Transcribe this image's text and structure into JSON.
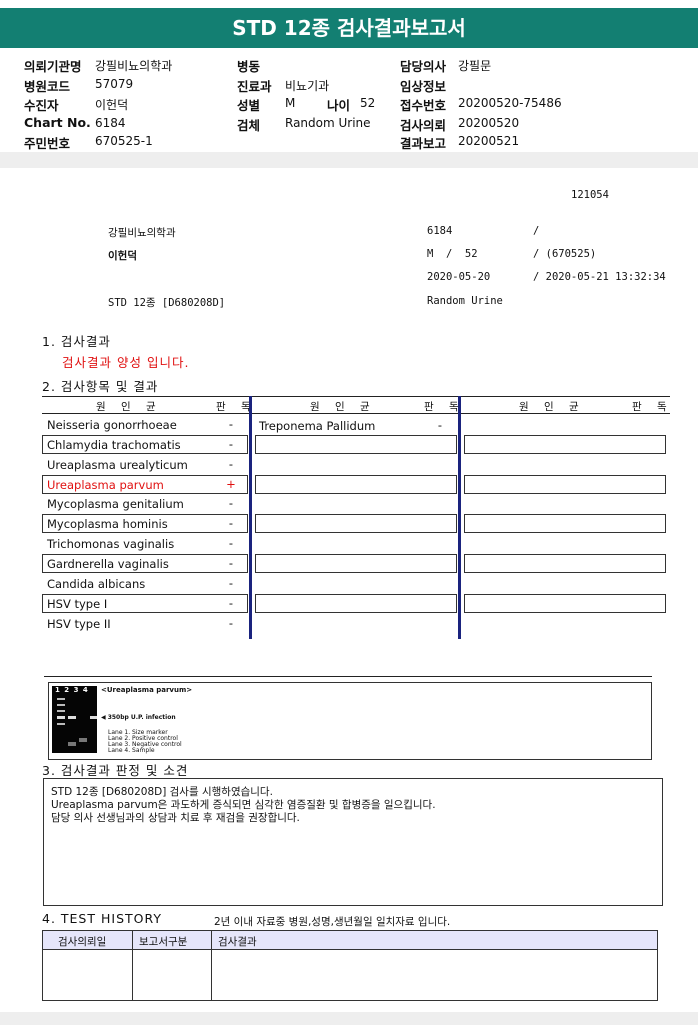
{
  "title": "STD 12종 검사결과보고서",
  "header": {
    "fields": [
      {
        "label": "의뢰기관명",
        "value": "강필비뇨의학과"
      },
      {
        "label": "병원코드",
        "value": "57079"
      },
      {
        "label": "수진자",
        "value": "이헌덕"
      },
      {
        "label": "Chart No.",
        "value": "6184"
      },
      {
        "label": "주민번호",
        "value": "670525-1"
      },
      {
        "label": "병동",
        "value": ""
      },
      {
        "label": "진료과",
        "value": "비뇨기과"
      },
      {
        "label": "성별",
        "value": "M"
      },
      {
        "label": "나이",
        "value": "52"
      },
      {
        "label": "검체",
        "value": "Random Urine"
      },
      {
        "label": "담당의사",
        "value": "강필문"
      },
      {
        "label": "임상정보",
        "value": ""
      },
      {
        "label": "접수번호",
        "value": "20200520-75486"
      },
      {
        "label": "검사의뢰",
        "value": "20200520"
      },
      {
        "label": "결과보고",
        "value": "20200521"
      }
    ]
  },
  "report": {
    "code": "121054",
    "clinic": "강필비뇨의학과",
    "chart": "6184",
    "slash1": "/",
    "patient": "이헌덕",
    "sex_age": "M  /  52",
    "id_part": "/ (670525)",
    "receipt_date": "2020-05-20",
    "report_datetime": "/ 2020-05-21 13:32:34",
    "test_name": "STD 12종 [D680208D]",
    "specimen": "Random Urine"
  },
  "section1": {
    "title": "1. 검사결과",
    "result": "검사결과 양성 입니다."
  },
  "section2": {
    "title": "2. 검사항목 및 결과",
    "col_pathogen": "원 인 균",
    "col_result": "판 독",
    "items": [
      {
        "name": "Neisseria gonorrhoeae",
        "result": "-"
      },
      {
        "name": "Chlamydia trachomatis",
        "result": "-"
      },
      {
        "name": "Ureaplasma urealyticum",
        "result": "-"
      },
      {
        "name": "Ureaplasma parvum",
        "result": "+"
      },
      {
        "name": "Mycoplasma genitalium",
        "result": "-"
      },
      {
        "name": "Mycoplasma hominis",
        "result": "-"
      },
      {
        "name": "Trichomonas vaginalis",
        "result": "-"
      },
      {
        "name": "Gardnerella vaginalis",
        "result": "-"
      },
      {
        "name": "Candida albicans",
        "result": "-"
      },
      {
        "name": "HSV type I",
        "result": "-"
      },
      {
        "name": "HSV type II",
        "result": "-"
      }
    ],
    "items2": [
      {
        "name": "Treponema Pallidum",
        "result": "-"
      }
    ]
  },
  "figure": {
    "lanes": "1 2 3 4",
    "title": "<Ureaplasma parvum>",
    "arrow_label": "◀ 350bp U.P. infection",
    "legend": [
      "Lane 1. Size marker",
      "Lane 2. Positive control",
      "Lane 3. Negative control",
      "Lane 4. Sample"
    ]
  },
  "section3": {
    "title": "3. 검사결과 판정 및 소견",
    "lines": [
      "STD 12종 [D680208D] 검사를 시행하였습니다.",
      "Ureaplasma parvum은 과도하게 증식되면 심각한 염증질환 및 합병증을 일으킵니다.",
      "담당 의사 선생님과의 상담과 치료 후 재검을 권장합니다."
    ]
  },
  "section4": {
    "title": "4. TEST HISTORY",
    "note": "2년 이내 자료중 병원,성명,생년월일 일치자료 입니다.",
    "columns": [
      "검사의뢰일",
      "보고서구분",
      "검사결과"
    ]
  },
  "colors": {
    "title_bar": "#137f72",
    "positive": "#e01010",
    "divider": "#1a237e"
  }
}
